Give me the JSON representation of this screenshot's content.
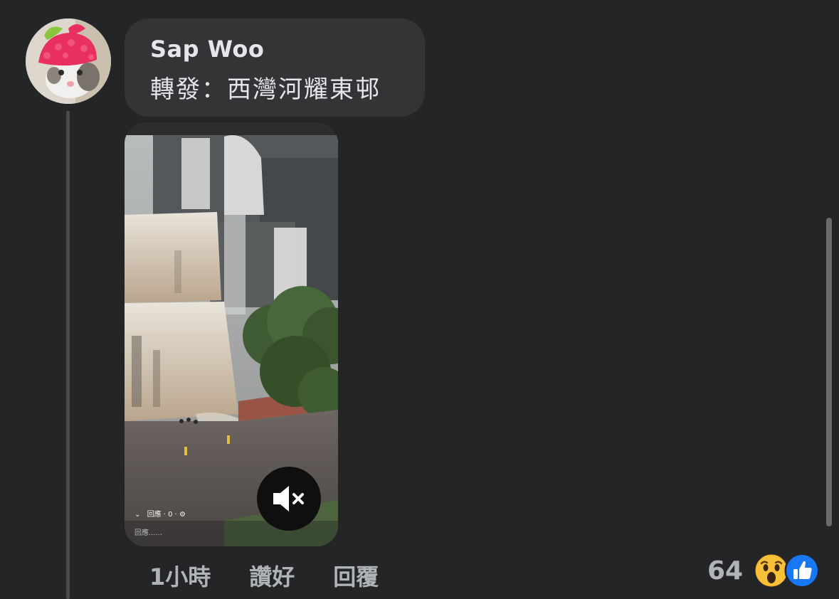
{
  "comment": {
    "author": "Sap Woo",
    "text": "轉發：西灣河耀東邨"
  },
  "video": {
    "overlay_status": "回應 · 0 ·",
    "overlay_hint": "回應......",
    "muted": true
  },
  "actions": {
    "timestamp": "1小時",
    "like_label": "讚好",
    "reply_label": "回覆"
  },
  "reactions": {
    "count": "64",
    "types": [
      "wow-icon",
      "like-icon"
    ]
  },
  "colors": {
    "background": "#242527",
    "bubble": "#333436",
    "text": "#e4e6eb",
    "secondary_text": "#b0b3b8",
    "like_blue": "#1877f2",
    "wow_yellow": "#f7c23a"
  }
}
